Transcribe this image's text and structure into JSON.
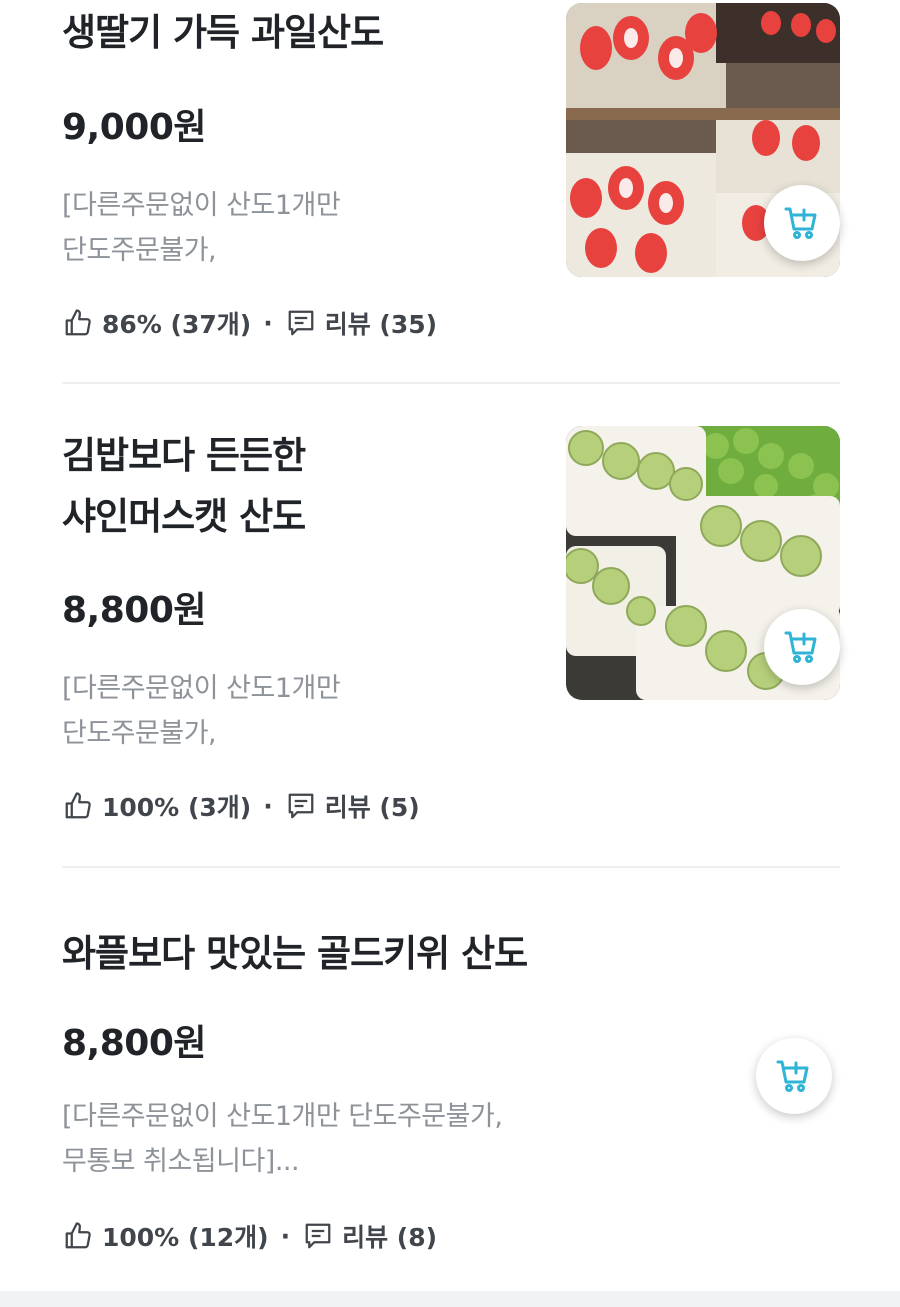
{
  "menu": {
    "items": [
      {
        "title_lines": [
          "생딸기 가득 과일산도"
        ],
        "price": "9,000원",
        "description_lines": [
          "[다른주문없이 산도1개만",
          "단도주문불가,"
        ],
        "rating": "86% (37개)",
        "separator": "·",
        "reviews": "리뷰 (35)",
        "photo": "strawberry-sando"
      },
      {
        "title_lines": [
          "김밥보다 든든한",
          "샤인머스캣 산도"
        ],
        "price": "8,800원",
        "description_lines": [
          "[다른주문없이 산도1개만",
          "단도주문불가,"
        ],
        "rating": "100% (3개)",
        "separator": "·",
        "reviews": "리뷰 (5)",
        "photo": "shine-muscat-sando"
      },
      {
        "title_lines": [
          "와플보다 맛있는 골드키위 산도"
        ],
        "price": "8,800원",
        "description_lines": [
          "[다른주문없이 산도1개만 단도주문불가,",
          "무통보 취소됩니다]..."
        ],
        "rating": "100% (12개)",
        "separator": "·",
        "reviews": "리뷰 (8)",
        "photo": null
      }
    ]
  },
  "icons": {
    "rating": "thumbs-up-icon",
    "reviews": "comment-icon",
    "cart": "add-to-cart-icon"
  },
  "colors": {
    "accent": "#2fb3d6",
    "text": "#202327",
    "muted": "#8e939a"
  }
}
